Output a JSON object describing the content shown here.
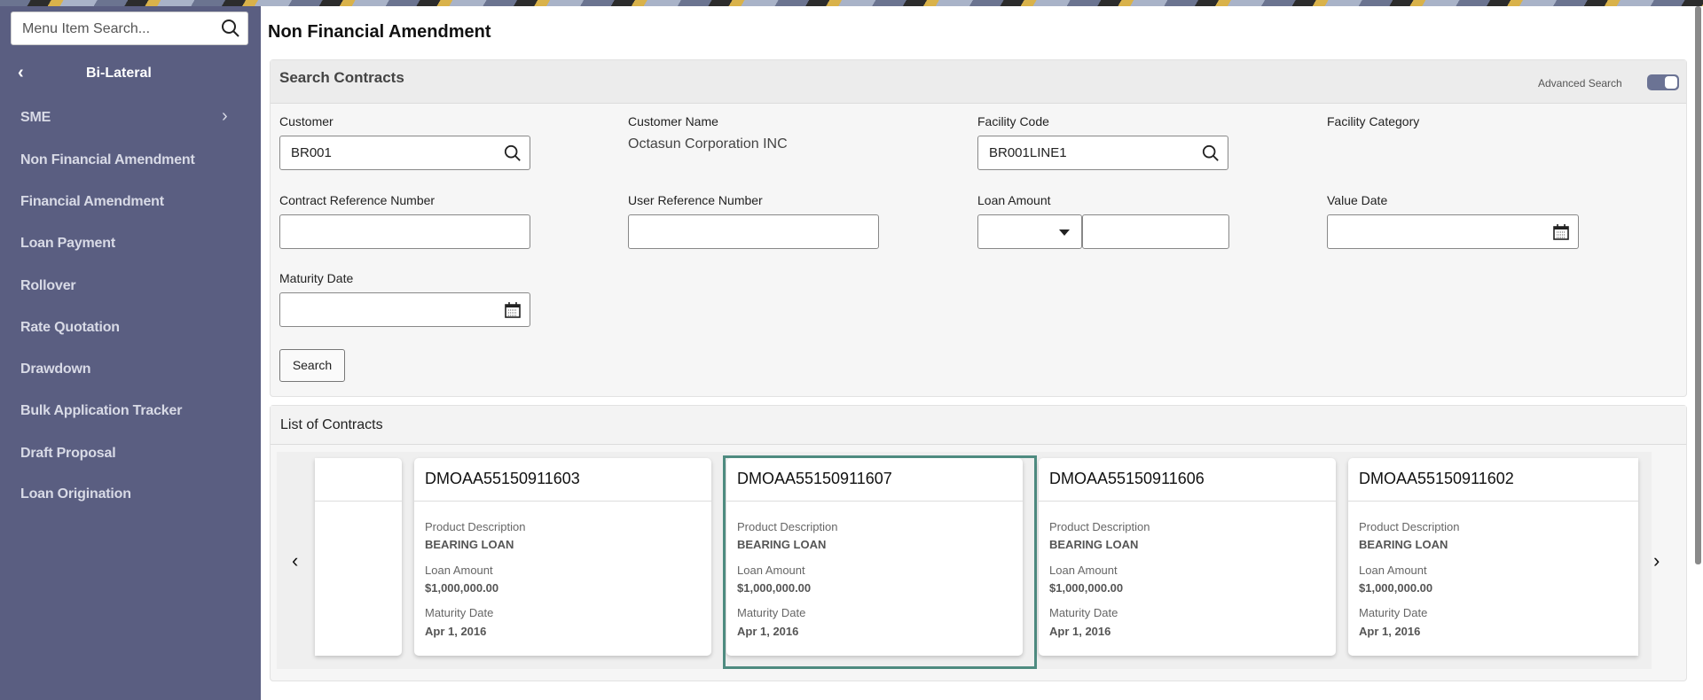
{
  "sidebar": {
    "search_placeholder": "Menu Item Search...",
    "section_title": "Bi-Lateral",
    "items": [
      {
        "label": "SME"
      },
      {
        "label": "Non Financial Amendment"
      },
      {
        "label": "Financial Amendment"
      },
      {
        "label": "Loan Payment"
      },
      {
        "label": "Rollover"
      },
      {
        "label": "Rate Quotation"
      },
      {
        "label": "Drawdown"
      },
      {
        "label": "Bulk Application Tracker"
      },
      {
        "label": "Draft Proposal"
      },
      {
        "label": "Loan Origination"
      }
    ]
  },
  "page_title": "Non Financial Amendment",
  "search": {
    "title": "Search Contracts",
    "advanced_label": "Advanced Search",
    "advanced_on": true,
    "customer_label": "Customer",
    "customer_value": "BR001",
    "customer_name_label": "Customer Name",
    "customer_name_value": "Octasun Corporation INC",
    "facility_code_label": "Facility Code",
    "facility_code_value": "BR001LINE1",
    "facility_category_label": "Facility Category",
    "contract_ref_label": "Contract Reference Number",
    "user_ref_label": "User Reference Number",
    "loan_amount_label": "Loan Amount",
    "value_date_label": "Value Date",
    "maturity_date_label": "Maturity Date",
    "search_button": "Search"
  },
  "list": {
    "title": "List of Contracts",
    "cards": [
      {
        "id": "DMOAA55150911603",
        "product_label": "Product Description",
        "product": "BEARING LOAN",
        "amount_label": "Loan Amount",
        "amount": "$1,000,000.00",
        "maturity_label": "Maturity Date",
        "maturity": "Apr 1, 2016"
      },
      {
        "id": "DMOAA55150911607",
        "product_label": "Product Description",
        "product": "BEARING LOAN",
        "amount_label": "Loan Amount",
        "amount": "$1,000,000.00",
        "maturity_label": "Maturity Date",
        "maturity": "Apr 1, 2016"
      },
      {
        "id": "DMOAA55150911606",
        "product_label": "Product Description",
        "product": "BEARING LOAN",
        "amount_label": "Loan Amount",
        "amount": "$1,000,000.00",
        "maturity_label": "Maturity Date",
        "maturity": "Apr 1, 2016"
      },
      {
        "id": "DMOAA55150911602",
        "product_label": "Product Description",
        "product": "BEARING LOAN",
        "amount_label": "Loan Amount",
        "amount": "$1,000,000.00",
        "maturity_label": "Maturity Date",
        "maturity": "Apr 1, 2016"
      }
    ],
    "selected_id": "DMOAA55150911607"
  }
}
